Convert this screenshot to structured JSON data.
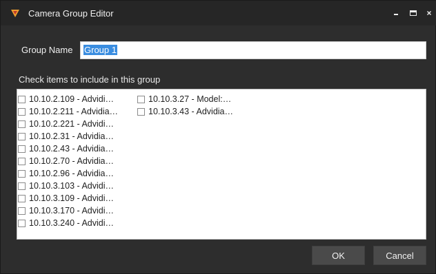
{
  "window": {
    "title": "Camera Group Editor",
    "accent_color": "#f0a030",
    "controls": {
      "minimize": "minimize-icon",
      "maximize": "maximize-icon",
      "close": "×"
    }
  },
  "form": {
    "group_name_label": "Group Name",
    "group_name_value": "Group 1",
    "instructions": "Check items to include in this group"
  },
  "list": {
    "column1": [
      "10.10.2.109 - Advidi…",
      "10.10.2.211 - Advidia…",
      "10.10.2.221 - Advidi…",
      "10.10.2.31 - Advidia…",
      "10.10.2.43 - Advidia…",
      "10.10.2.70 - Advidia…",
      "10.10.2.96 - Advidia…",
      "10.10.3.103 - Advidi…",
      "10.10.3.109 - Advidi…",
      "10.10.3.170 - Advidi…",
      "10.10.3.240 - Advidi…"
    ],
    "column2": [
      "10.10.3.27 - Model:…",
      "10.10.3.43 - Advidia…"
    ]
  },
  "buttons": {
    "ok": "OK",
    "cancel": "Cancel"
  }
}
